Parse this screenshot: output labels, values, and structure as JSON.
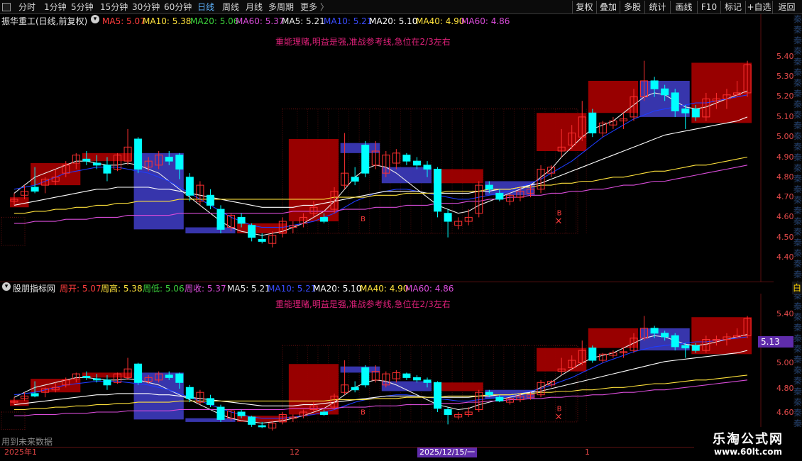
{
  "toolbar": {
    "tabs": [
      "分时",
      "1分钟",
      "5分钟",
      "15分钟",
      "30分钟",
      "60分钟",
      "日线",
      "周线",
      "月线",
      "多周期",
      "更多"
    ],
    "active_tab": "日线",
    "more_arrow": "〉",
    "right_buttons": [
      "复权",
      "叠加",
      "多股",
      "统计",
      "画线",
      "F10",
      "标记",
      "+自选",
      "返回"
    ]
  },
  "main_panel": {
    "stock_title": "振华重工(日线,前复权)",
    "indicators": [
      {
        "label": "MA5: 5.07",
        "color": "#ff3c3c"
      },
      {
        "label": "MA10: 5.38",
        "color": "#ffe23c"
      },
      {
        "label": "MA20: 5.06",
        "color": "#3cd23c"
      },
      {
        "label": "MA60: 5.37",
        "color": "#d94cd9"
      },
      {
        "label": "MA5: 5.21",
        "color": "#e8e8e8"
      },
      {
        "label": "MA10: 5.21",
        "color": "#3a4cff"
      },
      {
        "label": "MA20: 5.10",
        "color": "#ffffff"
      },
      {
        "label": "MA40: 4.90",
        "color": "#ffe23c"
      },
      {
        "label": "MA60: 4.86",
        "color": "#d94cd9"
      }
    ],
    "annotation": "重能理赌,明益是强,准战参考线,急位在2/3左右",
    "y_labels": [
      "5.40",
      "5.30",
      "5.20",
      "5.10",
      "5.00",
      "4.90",
      "4.80",
      "4.70",
      "4.60",
      "4.50",
      "4.40"
    ]
  },
  "sub_panel": {
    "title": "股朋指标网",
    "indicators": [
      {
        "label": "周开: 5.07",
        "color": "#ff3c3c"
      },
      {
        "label": "周高: 5.38",
        "color": "#ffe23c"
      },
      {
        "label": "周低: 5.06",
        "color": "#3cd23c"
      },
      {
        "label": "周收: 5.37",
        "color": "#d94cd9"
      },
      {
        "label": "MA5: 5.21",
        "color": "#e8e8e8"
      },
      {
        "label": "MA10: 5.21",
        "color": "#3a4cff"
      },
      {
        "label": "MA20: 5.10",
        "color": "#ffffff"
      },
      {
        "label": "MA40: 4.90",
        "color": "#ffe23c"
      },
      {
        "label": "MA60: 4.86",
        "color": "#d94cd9"
      }
    ],
    "annotation": "重能理赌,明益是强,准战参考线,急位在2/3左右",
    "y_labels": [
      "5.40",
      "5.13",
      "5.00",
      "4.80",
      "4.60"
    ],
    "current_price": "5.13"
  },
  "bottom": {
    "future_label": "用到未来数据",
    "dates": [
      "2025年1",
      "12",
      "1"
    ],
    "selected_date": "2025/12/15/一"
  },
  "side_strip": {
    "text": "秦秦秦秦秦秦秦秦秦秦秦秦秦秦秦秦秦秦秦秦秦秦秦秦秦秦秦秦秦秦秦秦秦秦秦秦秦秦秦秦",
    "tag": "白"
  },
  "watermark": {
    "line1": "乐淘公式网",
    "line2": "www.60lt.com"
  },
  "colors": {
    "up": "#ff3030",
    "down": "#00ffff",
    "week_up": "#a00000",
    "week_down": "#3a38b5",
    "ma5": "#e8e8e8",
    "ma10": "#1e3cff",
    "ma20": "#ffffff",
    "ma40": "#ffe23c",
    "ma60": "#d94cd9",
    "accent": "#5f2cab"
  },
  "chart_data": {
    "type": "candlestick",
    "price_range": [
      4.38,
      5.48
    ],
    "candles": [
      {
        "o": 4.68,
        "h": 4.72,
        "l": 4.66,
        "c": 4.69
      },
      {
        "o": 4.71,
        "h": 4.76,
        "l": 4.69,
        "c": 4.73
      },
      {
        "o": 4.75,
        "h": 4.85,
        "l": 4.72,
        "c": 4.73
      },
      {
        "o": 4.76,
        "h": 4.8,
        "l": 4.72,
        "c": 4.79
      },
      {
        "o": 4.78,
        "h": 4.84,
        "l": 4.76,
        "c": 4.8
      },
      {
        "o": 4.82,
        "h": 4.88,
        "l": 4.8,
        "c": 4.86
      },
      {
        "o": 4.87,
        "h": 4.92,
        "l": 4.84,
        "c": 4.91
      },
      {
        "o": 4.89,
        "h": 4.93,
        "l": 4.86,
        "c": 4.88
      },
      {
        "o": 4.87,
        "h": 4.91,
        "l": 4.84,
        "c": 4.86
      },
      {
        "o": 4.86,
        "h": 4.9,
        "l": 4.78,
        "c": 4.82
      },
      {
        "o": 4.84,
        "h": 4.92,
        "l": 4.83,
        "c": 4.91
      },
      {
        "o": 4.88,
        "h": 5.04,
        "l": 4.86,
        "c": 4.95
      },
      {
        "o": 4.99,
        "h": 5.0,
        "l": 4.82,
        "c": 4.84
      },
      {
        "o": 4.85,
        "h": 4.9,
        "l": 4.83,
        "c": 4.88
      },
      {
        "o": 4.86,
        "h": 4.93,
        "l": 4.84,
        "c": 4.91
      },
      {
        "o": 4.9,
        "h": 4.93,
        "l": 4.86,
        "c": 4.88
      },
      {
        "o": 4.91,
        "h": 4.92,
        "l": 4.79,
        "c": 4.84
      },
      {
        "o": 4.8,
        "h": 4.82,
        "l": 4.68,
        "c": 4.71
      },
      {
        "o": 4.68,
        "h": 4.78,
        "l": 4.66,
        "c": 4.76
      },
      {
        "o": 4.71,
        "h": 4.74,
        "l": 4.64,
        "c": 4.66
      },
      {
        "o": 4.64,
        "h": 4.66,
        "l": 4.52,
        "c": 4.54
      },
      {
        "o": 4.55,
        "h": 4.62,
        "l": 4.53,
        "c": 4.61
      },
      {
        "o": 4.6,
        "h": 4.62,
        "l": 4.55,
        "c": 4.57
      },
      {
        "o": 4.56,
        "h": 4.57,
        "l": 4.48,
        "c": 4.5
      },
      {
        "o": 4.49,
        "h": 4.52,
        "l": 4.47,
        "c": 4.48
      },
      {
        "o": 4.47,
        "h": 4.53,
        "l": 4.45,
        "c": 4.51
      },
      {
        "o": 4.52,
        "h": 4.6,
        "l": 4.5,
        "c": 4.58
      },
      {
        "o": 4.55,
        "h": 4.58,
        "l": 4.52,
        "c": 4.56
      },
      {
        "o": 4.57,
        "h": 4.62,
        "l": 4.55,
        "c": 4.6
      },
      {
        "o": 4.62,
        "h": 4.68,
        "l": 4.6,
        "c": 4.65
      },
      {
        "o": 4.6,
        "h": 4.62,
        "l": 4.57,
        "c": 4.58
      },
      {
        "o": 4.64,
        "h": 4.75,
        "l": 4.62,
        "c": 4.73
      },
      {
        "o": 4.76,
        "h": 5.02,
        "l": 4.74,
        "c": 4.82
      },
      {
        "o": 4.8,
        "h": 4.85,
        "l": 4.76,
        "c": 4.78
      },
      {
        "o": 4.96,
        "h": 4.98,
        "l": 4.8,
        "c": 4.82
      },
      {
        "o": 4.86,
        "h": 4.98,
        "l": 4.84,
        "c": 4.93
      },
      {
        "o": 4.82,
        "h": 4.93,
        "l": 4.8,
        "c": 4.91
      },
      {
        "o": 4.87,
        "h": 4.94,
        "l": 4.84,
        "c": 4.92
      },
      {
        "o": 4.91,
        "h": 4.92,
        "l": 4.86,
        "c": 4.88
      },
      {
        "o": 4.88,
        "h": 4.9,
        "l": 4.84,
        "c": 4.86
      },
      {
        "o": 4.86,
        "h": 4.88,
        "l": 4.8,
        "c": 4.84
      },
      {
        "o": 4.84,
        "h": 4.85,
        "l": 4.6,
        "c": 4.63
      },
      {
        "o": 4.62,
        "h": 4.64,
        "l": 4.5,
        "c": 4.58
      },
      {
        "o": 4.56,
        "h": 4.6,
        "l": 4.54,
        "c": 4.58
      },
      {
        "o": 4.58,
        "h": 4.64,
        "l": 4.56,
        "c": 4.6
      },
      {
        "o": 4.62,
        "h": 4.78,
        "l": 4.6,
        "c": 4.76
      },
      {
        "o": 4.76,
        "h": 4.78,
        "l": 4.72,
        "c": 4.74
      },
      {
        "o": 4.72,
        "h": 4.74,
        "l": 4.68,
        "c": 4.69
      },
      {
        "o": 4.68,
        "h": 4.72,
        "l": 4.66,
        "c": 4.71
      },
      {
        "o": 4.7,
        "h": 4.75,
        "l": 4.68,
        "c": 4.73
      },
      {
        "o": 4.72,
        "h": 4.76,
        "l": 4.7,
        "c": 4.74
      },
      {
        "o": 4.74,
        "h": 4.86,
        "l": 4.72,
        "c": 4.84
      },
      {
        "o": 4.82,
        "h": 4.86,
        "l": 4.8,
        "c": 4.85
      },
      {
        "o": 4.93,
        "h": 5.04,
        "l": 4.9,
        "c": 4.95
      },
      {
        "o": 4.96,
        "h": 5.06,
        "l": 4.94,
        "c": 5.02
      },
      {
        "o": 5.0,
        "h": 5.18,
        "l": 4.98,
        "c": 5.1
      },
      {
        "o": 5.12,
        "h": 5.14,
        "l": 5.0,
        "c": 5.02
      },
      {
        "o": 5.02,
        "h": 5.08,
        "l": 5.0,
        "c": 5.07
      },
      {
        "o": 5.06,
        "h": 5.1,
        "l": 5.04,
        "c": 5.08
      },
      {
        "o": 5.08,
        "h": 5.12,
        "l": 5.04,
        "c": 5.09
      },
      {
        "o": 5.1,
        "h": 5.24,
        "l": 5.08,
        "c": 5.2
      },
      {
        "o": 5.2,
        "h": 5.38,
        "l": 5.18,
        "c": 5.28
      },
      {
        "o": 5.28,
        "h": 5.3,
        "l": 5.2,
        "c": 5.24
      },
      {
        "o": 5.24,
        "h": 5.26,
        "l": 5.18,
        "c": 5.21
      },
      {
        "o": 5.22,
        "h": 5.24,
        "l": 5.1,
        "c": 5.13
      },
      {
        "o": 5.14,
        "h": 5.16,
        "l": 5.04,
        "c": 5.12
      },
      {
        "o": 5.14,
        "h": 5.16,
        "l": 5.08,
        "c": 5.1
      },
      {
        "o": 5.1,
        "h": 5.22,
        "l": 5.08,
        "c": 5.19
      },
      {
        "o": 5.18,
        "h": 5.22,
        "l": 5.14,
        "c": 5.19
      },
      {
        "o": 5.19,
        "h": 5.24,
        "l": 5.14,
        "c": 5.21
      },
      {
        "o": 5.21,
        "h": 5.28,
        "l": 5.2,
        "c": 5.22
      },
      {
        "o": 5.22,
        "h": 5.38,
        "l": 5.2,
        "c": 5.36
      }
    ],
    "weekly_boxes": [
      {
        "from": 0,
        "to": 1,
        "o": 4.7,
        "c": 4.65,
        "up": true
      },
      {
        "from": 2,
        "to": 6,
        "o": 4.76,
        "c": 4.87,
        "up": true
      },
      {
        "from": 7,
        "to": 11,
        "o": 4.88,
        "c": 4.92,
        "up": true
      },
      {
        "from": 12,
        "to": 16,
        "o": 4.92,
        "c": 4.54,
        "up": false
      },
      {
        "from": 17,
        "to": 21,
        "o": 4.55,
        "c": 4.52,
        "up": false
      },
      {
        "from": 22,
        "to": 26,
        "o": 4.52,
        "c": 4.57,
        "up": true
      },
      {
        "from": 27,
        "to": 31,
        "o": 4.58,
        "c": 4.99,
        "up": true
      },
      {
        "from": 32,
        "to": 35,
        "o": 4.97,
        "c": 4.92,
        "up": false
      },
      {
        "from": 36,
        "to": 40,
        "o": 4.85,
        "c": 4.77,
        "up": false
      },
      {
        "from": 41,
        "to": 45,
        "o": 4.77,
        "c": 4.84,
        "up": true
      },
      {
        "from": 46,
        "to": 50,
        "o": 4.78,
        "c": 4.71,
        "up": false
      },
      {
        "from": 51,
        "to": 55,
        "o": 4.93,
        "c": 5.12,
        "up": true
      },
      {
        "from": 56,
        "to": 60,
        "o": 5.12,
        "c": 5.28,
        "up": true
      },
      {
        "from": 61,
        "to": 65,
        "o": 5.28,
        "c": 5.1,
        "up": false
      },
      {
        "from": 66,
        "to": 71,
        "o": 5.07,
        "c": 5.37,
        "up": true
      }
    ],
    "ma_series": [
      {
        "key": "ma5",
        "values": [
          4.72,
          4.76,
          4.8,
          4.82,
          4.84,
          4.86,
          4.88,
          4.88,
          4.87,
          4.86,
          4.86,
          4.87,
          4.86,
          4.84,
          4.82,
          4.78,
          4.74,
          4.7,
          4.66,
          4.62,
          4.58,
          4.55,
          4.53,
          4.52,
          4.51,
          4.52,
          4.53,
          4.55,
          4.57,
          4.6,
          4.63,
          4.68,
          4.74,
          4.8,
          4.84,
          4.86,
          4.85,
          4.82,
          4.78,
          4.74,
          4.7,
          4.66,
          4.64,
          4.62,
          4.63,
          4.66,
          4.68,
          4.7,
          4.72,
          4.74,
          4.76,
          4.8,
          4.84,
          4.9,
          4.95,
          5.0,
          5.04,
          5.06,
          5.08,
          5.12,
          5.16,
          5.2,
          5.22,
          5.21,
          5.18,
          5.15,
          5.14,
          5.15,
          5.17,
          5.19,
          5.21,
          5.23
        ]
      },
      {
        "key": "ma10",
        "values": [
          4.74,
          4.75,
          4.76,
          4.78,
          4.8,
          4.82,
          4.83,
          4.84,
          4.85,
          4.85,
          4.85,
          4.84,
          4.83,
          4.82,
          4.8,
          4.78,
          4.75,
          4.72,
          4.69,
          4.66,
          4.63,
          4.6,
          4.58,
          4.56,
          4.55,
          4.55,
          4.55,
          4.56,
          4.57,
          4.58,
          4.6,
          4.62,
          4.65,
          4.68,
          4.7,
          4.72,
          4.73,
          4.74,
          4.74,
          4.73,
          4.72,
          4.71,
          4.7,
          4.69,
          4.69,
          4.7,
          4.71,
          4.72,
          4.73,
          4.75,
          4.77,
          4.79,
          4.82,
          4.85,
          4.88,
          4.92,
          4.96,
          5.0,
          5.03,
          5.06,
          5.09,
          5.11,
          5.13,
          5.14,
          5.15,
          5.16,
          5.17,
          5.17,
          5.18,
          5.19,
          5.2,
          5.21
        ]
      },
      {
        "key": "ma20",
        "values": [
          4.66,
          4.67,
          4.68,
          4.69,
          4.7,
          4.71,
          4.72,
          4.73,
          4.74,
          4.74,
          4.75,
          4.75,
          4.75,
          4.75,
          4.74,
          4.74,
          4.73,
          4.72,
          4.71,
          4.7,
          4.69,
          4.68,
          4.67,
          4.66,
          4.65,
          4.65,
          4.65,
          4.65,
          4.66,
          4.66,
          4.67,
          4.68,
          4.69,
          4.7,
          4.71,
          4.72,
          4.73,
          4.73,
          4.73,
          4.73,
          4.72,
          4.72,
          4.72,
          4.72,
          4.72,
          4.73,
          4.73,
          4.74,
          4.74,
          4.75,
          4.76,
          4.77,
          4.79,
          4.81,
          4.83,
          4.85,
          4.87,
          4.89,
          4.91,
          4.93,
          4.95,
          4.97,
          4.99,
          5.01,
          5.02,
          5.03,
          5.04,
          5.05,
          5.06,
          5.07,
          5.08,
          5.1
        ]
      },
      {
        "key": "ma40",
        "values": [
          4.62,
          4.62,
          4.63,
          4.63,
          4.64,
          4.64,
          4.65,
          4.65,
          4.66,
          4.66,
          4.67,
          4.67,
          4.68,
          4.68,
          4.68,
          4.68,
          4.69,
          4.69,
          4.69,
          4.69,
          4.69,
          4.69,
          4.69,
          4.69,
          4.69,
          4.69,
          4.69,
          4.69,
          4.69,
          4.69,
          4.69,
          4.7,
          4.7,
          4.7,
          4.7,
          4.71,
          4.71,
          4.71,
          4.72,
          4.72,
          4.72,
          4.72,
          4.73,
          4.73,
          4.73,
          4.73,
          4.74,
          4.74,
          4.74,
          4.75,
          4.75,
          4.76,
          4.76,
          4.77,
          4.77,
          4.78,
          4.78,
          4.79,
          4.8,
          4.8,
          4.81,
          4.82,
          4.83,
          4.83,
          4.84,
          4.85,
          4.86,
          4.86,
          4.87,
          4.88,
          4.89,
          4.9
        ]
      },
      {
        "key": "ma60",
        "values": [
          4.57,
          4.57,
          4.58,
          4.58,
          4.58,
          4.59,
          4.59,
          4.59,
          4.6,
          4.6,
          4.6,
          4.61,
          4.61,
          4.61,
          4.61,
          4.61,
          4.62,
          4.62,
          4.62,
          4.62,
          4.62,
          4.62,
          4.62,
          4.62,
          4.62,
          4.62,
          4.62,
          4.63,
          4.63,
          4.63,
          4.63,
          4.63,
          4.64,
          4.64,
          4.64,
          4.65,
          4.65,
          4.65,
          4.66,
          4.66,
          4.66,
          4.67,
          4.67,
          4.67,
          4.68,
          4.68,
          4.69,
          4.69,
          4.7,
          4.7,
          4.71,
          4.71,
          4.72,
          4.72,
          4.73,
          4.73,
          4.74,
          4.74,
          4.75,
          4.76,
          4.76,
          4.77,
          4.78,
          4.78,
          4.79,
          4.8,
          4.81,
          4.82,
          4.83,
          4.84,
          4.85,
          4.86
        ]
      }
    ],
    "markers": [
      {
        "i": 52,
        "price": 4.61,
        "label": "B",
        "symbol": "x"
      },
      {
        "i": 33,
        "price": 4.58,
        "label": "B",
        "symbol": ""
      }
    ]
  }
}
